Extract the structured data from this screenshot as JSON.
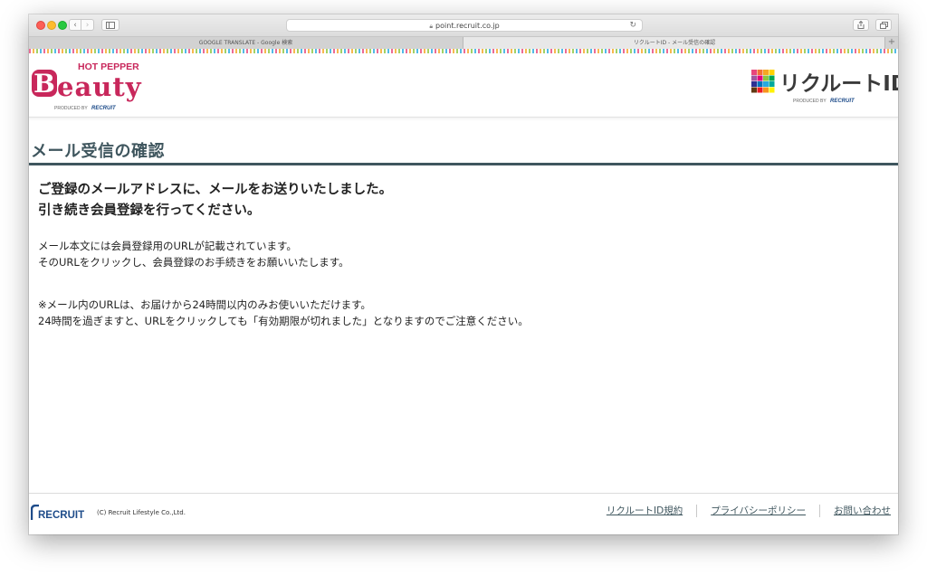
{
  "browser": {
    "url": "point.recruit.co.jp",
    "tabs": [
      {
        "label": "GOOGLE TRANSLATE - Google 検索"
      },
      {
        "label": "リクルートID - メール受信の確認"
      }
    ]
  },
  "header": {
    "brand_small": "HOT PEPPER",
    "brand_large_initial": "B",
    "brand_large_rest": "eauty",
    "produced_by": "PRODUCED BY",
    "recruit_small": "RECRUIT",
    "rid_logo_text": "リクルートID",
    "rid_produced_by": "PRODUCED BY",
    "rid_recruit": "RECRUIT"
  },
  "main": {
    "title": "メール受信の確認",
    "lead_line1": "ご登録のメールアドレスに、メールをお送りいたしました。",
    "lead_line2": "引き続き会員登録を行ってください。",
    "body1_line1": "メール本文には会員登録用のURLが記載されています。",
    "body1_line2": "そのURLをクリックし、会員登録のお手続きをお願いいたします。",
    "body2_line1": "※メール内のURLは、お届けから24時間以内のみお使いいただけます。",
    "body2_line2": "24時間を過ぎますと、URLをクリックしても「有効期限が切れました」となりますのでご注意ください。"
  },
  "footer": {
    "logo_text": "RECRUIT",
    "copyright": "(C) Recruit Lifestyle Co.,Ltd.",
    "links": [
      {
        "label": "リクルートID規約"
      },
      {
        "label": "プライバシーポリシー"
      },
      {
        "label": "お問い合わせ"
      }
    ]
  },
  "colors": {
    "brand_pink": "#c8275b",
    "heading": "#3f565e"
  }
}
